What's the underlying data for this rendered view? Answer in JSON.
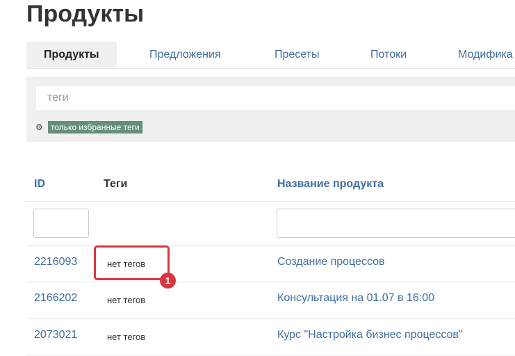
{
  "page": {
    "title": "Продукты"
  },
  "tabs": [
    {
      "label": "Продукты",
      "active": true
    },
    {
      "label": "Предложения",
      "active": false
    },
    {
      "label": "Пресеты",
      "active": false
    },
    {
      "label": "Потоки",
      "active": false
    },
    {
      "label": "Модифика",
      "active": false
    }
  ],
  "filter": {
    "tags_placeholder": "теги",
    "tags_value": "",
    "favorite_tags_label": "только избранные теги",
    "icon": "gear-icon"
  },
  "table": {
    "columns": {
      "id": "ID",
      "tags": "Теги",
      "name": "Название продукта"
    },
    "rows": [
      {
        "id": "2216093",
        "tags": "нет тегов",
        "name": "Создание процессов"
      },
      {
        "id": "2166202",
        "tags": "нет тегов",
        "name": "Консультация на 01.07 в 16:00"
      },
      {
        "id": "2073021",
        "tags": "нет тегов",
        "name": "Курс \"Настройка бизнес процессов\""
      }
    ]
  },
  "annotation": {
    "badge": "1",
    "color": "#d9363e"
  },
  "colors": {
    "link": "#3e6ea1",
    "tag_bg": "#668f7a",
    "panel_bg": "#f0f0f0"
  }
}
